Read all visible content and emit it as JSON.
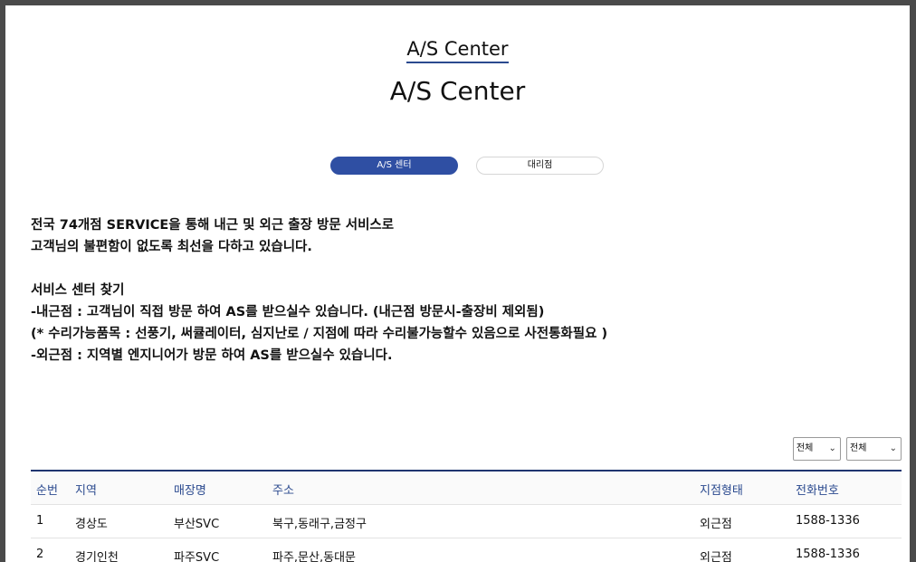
{
  "header": {
    "small_title": "A/S Center",
    "big_title": "A/S Center"
  },
  "tabs": [
    {
      "label": "A/S 센터"
    },
    {
      "label": "대리점"
    }
  ],
  "intro": {
    "line1": "전국 74개점 SERVICE을 통해 내근 및 외근 출장 방문 서비스로",
    "line2": "고객님의 불편함이 없도록 최선을 다하고 있습니다.",
    "line3": "서비스 센터 찾기",
    "line4": "-내근점 : 고객님이 직접 방문 하여 AS를 받으실수 있습니다. (내근점 방문시-출장비 제외됨)",
    "line5": "(* 수리가능품목 : 선풍기, 써큘레이터, 심지난로 / 지점에 따라 수리불가능할수 있음으로 사전통화필요 )",
    "line6": "-외근점 : 지역별 엔지니어가 방문 하여 AS를 받으실수 있습니다."
  },
  "filters": {
    "region_select": "전체",
    "type_select": "전체"
  },
  "table": {
    "headers": [
      "순번",
      "지역",
      "매장명",
      "주소",
      "지점형태",
      "전화번호"
    ],
    "rows": [
      [
        "1",
        "경상도",
        "부산SVC",
        "북구,동래구,금정구",
        "외근점",
        "1588-1336"
      ],
      [
        "2",
        "경기인천",
        "파주SVC",
        "파주,문산,동대문",
        "외근점",
        "1588-1336"
      ]
    ]
  }
}
